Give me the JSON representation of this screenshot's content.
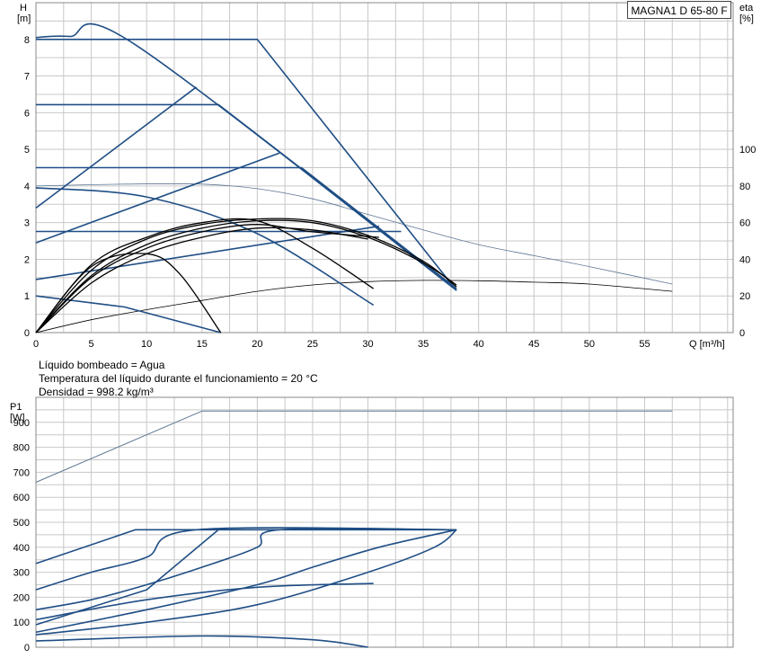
{
  "model": "MAGNA1 D 65-80 F",
  "info": [
    "Líquido bombeado = Agua",
    "Temperatura del líquido durante el funcionamiento = 20 °C",
    "Densidad = 998.2 kg/m³"
  ],
  "colors": {
    "blue": "#1f4e85",
    "thin_blue": "#5e7794",
    "black": "#000000",
    "grid": "#c8c8c8"
  },
  "chart_data": [
    {
      "type": "line",
      "ylabel_top": "H",
      "ylabel_unit": "[m]",
      "right_label_top": "eta",
      "right_label_unit": "[%]",
      "xlabel": "Q [m³/h]",
      "xlim": [
        0,
        63
      ],
      "ylim": [
        0,
        9
      ],
      "x_ticks": [
        0,
        5,
        10,
        15,
        20,
        25,
        30,
        35,
        40,
        45,
        50,
        55
      ],
      "y_ticks": [
        0,
        1,
        2,
        3,
        4,
        5,
        6,
        7,
        8
      ],
      "right_ticks": [
        0,
        20,
        40,
        60,
        80,
        100
      ],
      "right_range": [
        0,
        180
      ],
      "grid": true,
      "head_curves": [
        {
          "x": [
            0,
            3,
            9,
            38
          ],
          "y": [
            8.05,
            8.08,
            7.85,
            1.15
          ]
        },
        {
          "x": [
            0,
            20,
            38
          ],
          "y": [
            8.0,
            8.0,
            1.15
          ]
        },
        {
          "x": [
            0,
            16.5,
            38
          ],
          "y": [
            6.22,
            6.22,
            1.2
          ]
        },
        {
          "x": [
            0,
            24,
            38
          ],
          "y": [
            4.5,
            4.5,
            1.2
          ]
        },
        {
          "x": [
            0,
            10,
            20,
            30.5
          ],
          "y": [
            3.95,
            3.7,
            2.7,
            0.75
          ]
        },
        {
          "x": [
            0,
            33
          ],
          "y": [
            2.76,
            2.76
          ]
        },
        {
          "x": [
            0,
            8,
            16.7
          ],
          "y": [
            1.0,
            0.7,
            0
          ]
        },
        {
          "x": [
            0,
            14.5
          ],
          "y": [
            3.4,
            6.7
          ]
        },
        {
          "x": [
            0,
            22
          ],
          "y": [
            2.45,
            4.9
          ]
        },
        {
          "x": [
            0,
            31
          ],
          "y": [
            1.45,
            2.9
          ]
        }
      ],
      "system_curves": [
        {
          "x": [
            0,
            5,
            10,
            15,
            20,
            25,
            30
          ],
          "y": [
            0,
            1.35,
            2.15,
            2.6,
            2.85,
            2.8,
            2.55
          ]
        },
        {
          "x": [
            0,
            5,
            10,
            15,
            20,
            25,
            31
          ],
          "y": [
            0,
            1.5,
            2.3,
            2.75,
            2.95,
            2.75,
            2.6
          ]
        },
        {
          "x": [
            0,
            5,
            10,
            15,
            20,
            25,
            30,
            35,
            38
          ],
          "y": [
            0,
            1.55,
            2.4,
            2.85,
            3.05,
            3.0,
            2.6,
            1.9,
            1.3
          ]
        },
        {
          "x": [
            0,
            5,
            10,
            15,
            20,
            25,
            30,
            35,
            38
          ],
          "y": [
            0,
            1.7,
            2.55,
            2.95,
            3.1,
            3.05,
            2.65,
            1.95,
            1.25
          ]
        },
        {
          "x": [
            0,
            5,
            10,
            15,
            20,
            25,
            30.5
          ],
          "y": [
            0,
            1.85,
            2.6,
            3.0,
            3.05,
            2.3,
            1.2
          ]
        },
        {
          "x": [
            0,
            5,
            10,
            13,
            16.7
          ],
          "y": [
            0,
            1.8,
            2.15,
            1.6,
            0
          ]
        }
      ],
      "eta_curves": [
        {
          "x": [
            0,
            8,
            15,
            20,
            25,
            30,
            35,
            40,
            45,
            50,
            57.5
          ],
          "y": [
            80,
            81,
            81,
            78.5,
            73,
            64.5,
            56,
            48,
            42,
            36,
            26.5
          ]
        },
        {
          "x": [
            0,
            5,
            10,
            15,
            20,
            25,
            30,
            35,
            40,
            45,
            50,
            57.5
          ],
          "y": [
            0,
            7,
            12.5,
            17.5,
            22.5,
            26,
            27.8,
            28.5,
            28.3,
            27.5,
            26.5,
            22.5
          ]
        }
      ]
    },
    {
      "type": "line",
      "ylabel_top": "P1",
      "ylabel_unit": "[W]",
      "xlim": [
        0,
        63
      ],
      "ylim": [
        0,
        1000
      ],
      "y_ticks": [
        0,
        100,
        200,
        300,
        400,
        500,
        600,
        700,
        800,
        900
      ],
      "grid": true,
      "power_curves": [
        {
          "x": [
            0,
            15,
            57.5
          ],
          "y": [
            660,
            945,
            945
          ]
        },
        {
          "x": [
            0,
            9,
            38
          ],
          "y": [
            335,
            470,
            470
          ]
        },
        {
          "x": [
            0,
            5,
            10,
            14.5,
            38
          ],
          "y": [
            230,
            300,
            360,
            470,
            470
          ]
        },
        {
          "x": [
            0,
            5,
            10,
            15,
            20,
            22,
            38
          ],
          "y": [
            150,
            190,
            250,
            320,
            400,
            470,
            470
          ]
        },
        {
          "x": [
            0,
            10,
            20,
            25,
            31,
            38
          ],
          "y": [
            60,
            150,
            250,
            320,
            400,
            470
          ]
        },
        {
          "x": [
            0,
            10,
            20,
            30,
            36,
            38
          ],
          "y": [
            50,
            100,
            170,
            300,
            400,
            470
          ]
        },
        {
          "x": [
            0,
            10,
            20,
            30.5
          ],
          "y": [
            110,
            190,
            240,
            255
          ]
        },
        {
          "x": [
            0,
            10,
            16.5
          ],
          "y": [
            90,
            230,
            470
          ]
        },
        {
          "x": [
            0,
            15,
            25,
            30
          ],
          "y": [
            25,
            45,
            30,
            0
          ]
        }
      ]
    }
  ]
}
